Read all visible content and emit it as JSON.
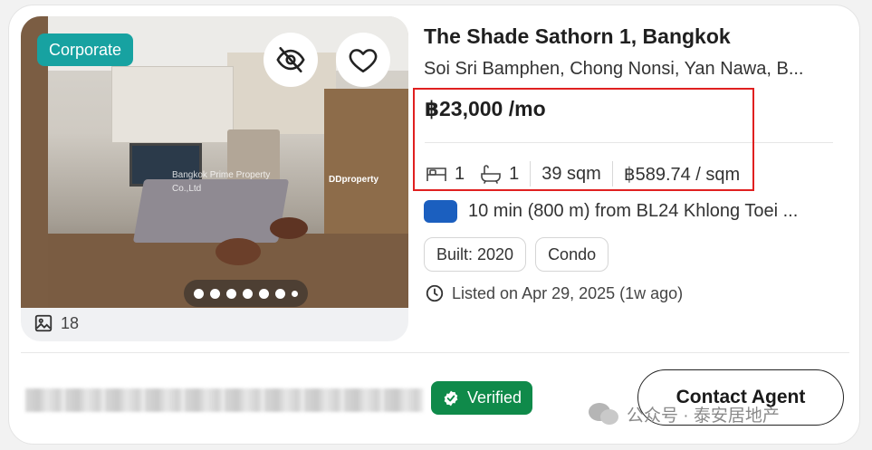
{
  "listing": {
    "badge": "Corporate",
    "photo_count": "18",
    "watermark_agency": "Bangkok Prime Property Co.,Ltd",
    "watermark_brand": "DDproperty",
    "title": "The Shade Sathorn 1, Bangkok",
    "address": "Soi Sri Bamphen, Chong Nonsi, Yan Nawa, B...",
    "price": "฿23,000 /mo",
    "beds": "1",
    "baths": "1",
    "area": "39 sqm",
    "price_per_sqm": "฿589.74 / sqm",
    "transit": "10 min (800 m) from BL24 Khlong Toei ...",
    "tags": [
      "Built: 2020",
      "Condo"
    ],
    "listed": "Listed on Apr 29, 2025 (1w ago)"
  },
  "agent": {
    "verified_label": "Verified",
    "contact_label": "Contact Agent"
  },
  "watermark": {
    "text": "公众号 · 泰安居地产"
  },
  "carousel": {
    "total_dots": 7,
    "active_index": 0
  },
  "colors": {
    "corporate_badge": "#17a2a1",
    "verified_badge": "#0f8a4a",
    "transit_chip": "#1b5fbf",
    "highlight_box": "#e02020"
  },
  "icons": [
    "eye-off-icon",
    "heart-icon",
    "gallery-icon",
    "bed-icon",
    "bath-icon",
    "clock-icon",
    "shield-check-icon",
    "wechat-icon"
  ]
}
